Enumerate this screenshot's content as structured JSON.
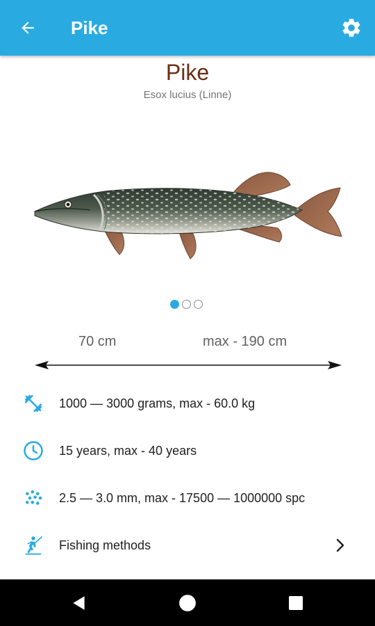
{
  "appbar": {
    "title": "Pike",
    "back_icon": "arrow-back-icon",
    "settings_icon": "gear-icon",
    "color": "#29ABE2"
  },
  "fish": {
    "name": "Pike",
    "latin_name": "Esox lucius (Linne)",
    "name_color": "#6B2E12"
  },
  "pager": {
    "total": 3,
    "active_index": 0
  },
  "length": {
    "typical": "70 cm",
    "max": "max - 190 cm"
  },
  "details": [
    {
      "icon": "dumbbell-icon",
      "text": "1000 — 3000 grams, max - 60.0 kg"
    },
    {
      "icon": "clock-icon",
      "text": "15 years, max - 40 years"
    },
    {
      "icon": "eggs-icon",
      "text": "2.5 — 3.0 mm, max - 17500 — 1000000 spc"
    },
    {
      "icon": "fisherman-icon",
      "text": "Fishing methods"
    }
  ],
  "navbar": {
    "back_icon": "nav-back-icon",
    "home_icon": "nav-home-icon",
    "recents_icon": "nav-recents-icon"
  }
}
